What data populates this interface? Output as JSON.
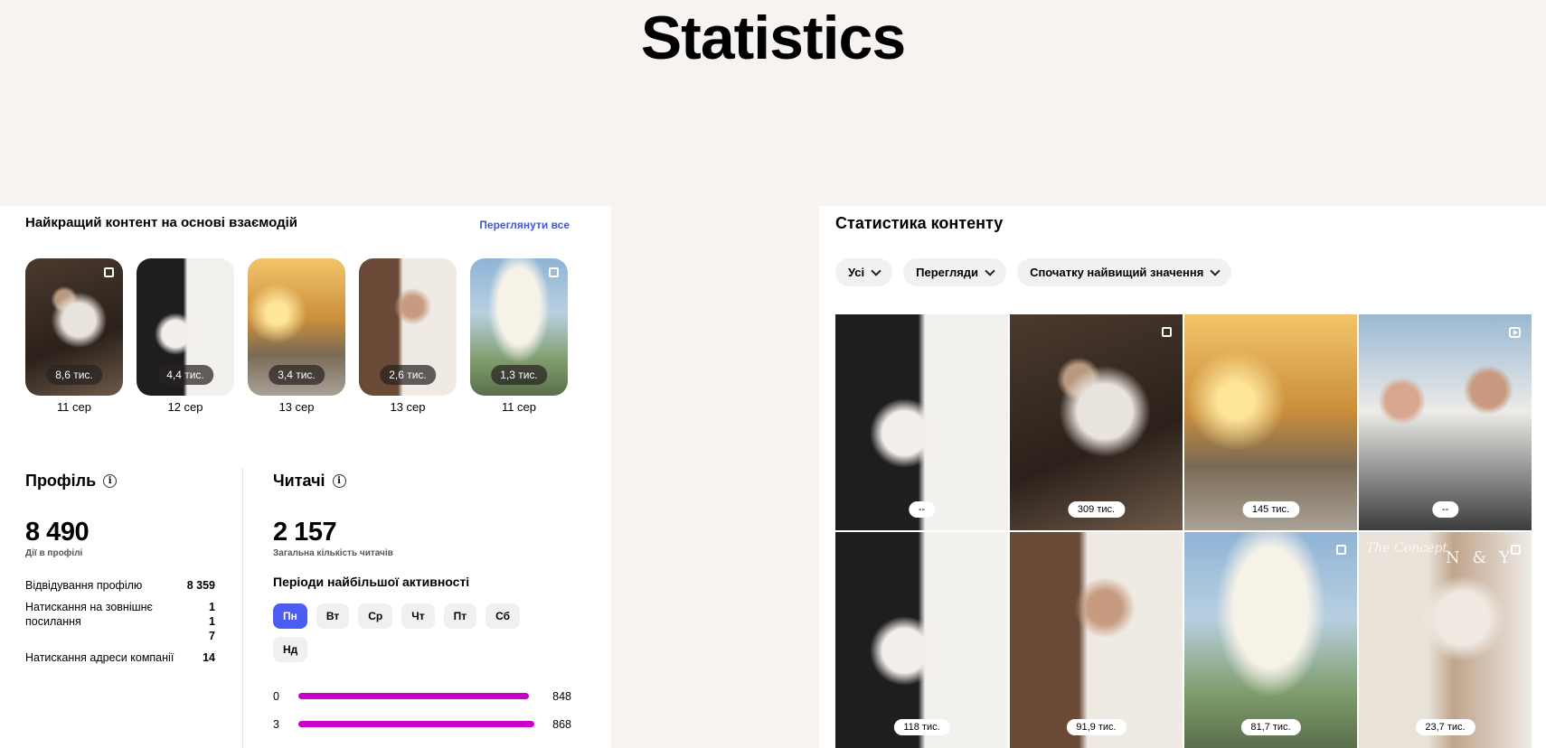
{
  "page_title": "Statistics",
  "left": {
    "heading": "Найкращий контент на основі взаємодій",
    "view_all": "Переглянути все",
    "top_items": [
      {
        "badge": "8,6 тис.",
        "date": "11 сер",
        "style": "p-dark"
      },
      {
        "badge": "4,4 тис.",
        "date": "12 сер",
        "style": "p-bw"
      },
      {
        "badge": "3,4 тис.",
        "date": "13 сер",
        "style": "p-sunset"
      },
      {
        "badge": "2,6 тис.",
        "date": "13 сер",
        "style": "p-kiss"
      },
      {
        "badge": "1,3 тис.",
        "date": "11 сер",
        "style": "p-pampas"
      }
    ],
    "profile": {
      "title": "Профіль",
      "info_icon": "i",
      "total": "8 490",
      "total_caption": "Дії в профілі",
      "rows": [
        {
          "label": "Відвідування профілю",
          "value": "8 359"
        },
        {
          "label": "Натискання на зовнішнє посилання",
          "value": "1\n1\n7"
        },
        {
          "label": "Натискання адреси компанії",
          "value": "14"
        }
      ]
    },
    "readers": {
      "title": "Читачі",
      "info_icon": "i",
      "total": "2 157",
      "total_caption": "Загальна кількість читачів",
      "activity_title": "Періоди найбільшої активності",
      "days": [
        "Пн",
        "Вт",
        "Ср",
        "Чт",
        "Пт",
        "Сб",
        "Нд"
      ],
      "active_day_index": 0,
      "bars": [
        {
          "hour": "0",
          "value": "848",
          "fraction": 0.977
        },
        {
          "hour": "3",
          "value": "868",
          "fraction": 1.0
        }
      ]
    }
  },
  "right": {
    "heading": "Статистика контенту",
    "filters": [
      "Усі",
      "Перегляди",
      "Спочатку найвищий значення"
    ],
    "grid": [
      {
        "badge": "--",
        "style": "p-bw",
        "icon": "none"
      },
      {
        "badge": "309 тис.",
        "style": "p-dark",
        "icon": "carousel"
      },
      {
        "badge": "145 тис.",
        "style": "p-sunset",
        "icon": "none"
      },
      {
        "badge": "--",
        "style": "p-selfie",
        "icon": "reel"
      },
      {
        "badge": "118 тис.",
        "style": "p-bw",
        "icon": "none"
      },
      {
        "badge": "91,9 тис.",
        "style": "p-kiss",
        "icon": "none"
      },
      {
        "badge": "81,7 тис.",
        "style": "p-pampas",
        "icon": "carousel"
      },
      {
        "badge": "23,7 тис.",
        "style": "p-couple2",
        "icon": "carousel",
        "watermark": "N & Y",
        "script": "The Concept"
      }
    ]
  }
}
